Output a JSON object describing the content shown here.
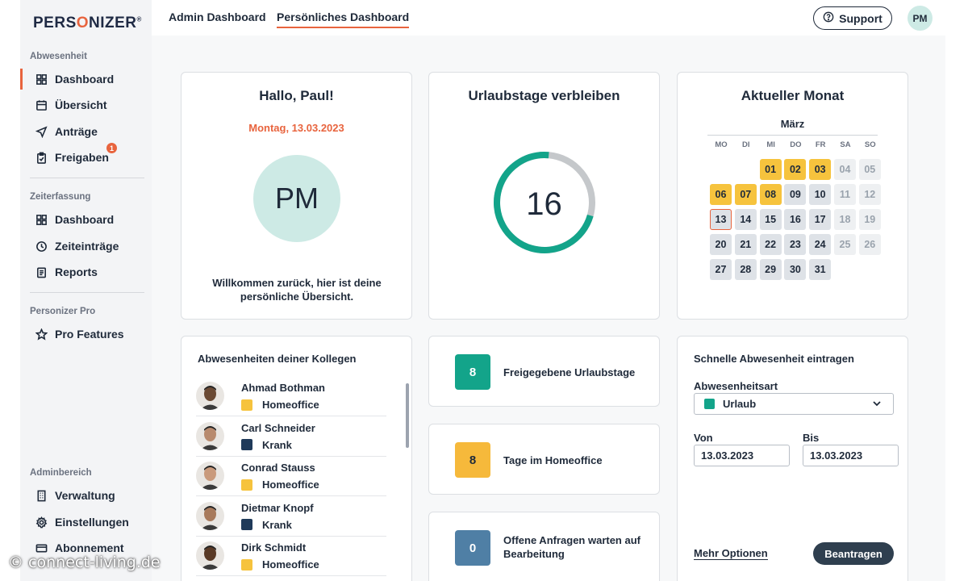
{
  "logo": {
    "text_pre": "PERS",
    "text_o": "O",
    "text_post": "NIZER",
    "mark": "®"
  },
  "sidebar": {
    "sections": [
      {
        "title": "Abwesenheit"
      },
      {
        "title": "Zeiterfassung"
      },
      {
        "title": "Personizer Pro"
      },
      {
        "title": "Adminbereich"
      }
    ],
    "items": [
      {
        "label": "Dashboard",
        "icon": "grid-icon",
        "active": true
      },
      {
        "label": "Übersicht",
        "icon": "calendar-icon"
      },
      {
        "label": "Anträge",
        "icon": "send-icon"
      },
      {
        "label": "Freigaben",
        "icon": "clipboard-check-icon",
        "badge": "1"
      },
      {
        "label": "Dashboard",
        "icon": "grid-icon"
      },
      {
        "label": "Zeiteinträge",
        "icon": "clock-icon"
      },
      {
        "label": "Reports",
        "icon": "report-icon"
      },
      {
        "label": "Pro Features",
        "icon": "star-icon"
      },
      {
        "label": "Verwaltung",
        "icon": "building-icon"
      },
      {
        "label": "Einstellungen",
        "icon": "gear-icon"
      },
      {
        "label": "Abonnement",
        "icon": "card-icon"
      }
    ]
  },
  "header": {
    "tabs": [
      {
        "label": "Admin Dashboard"
      },
      {
        "label": "Persönliches Dashboard",
        "active": true
      }
    ],
    "support_label": "Support",
    "user_initials": "PM"
  },
  "greeting": {
    "title": "Hallo, Paul!",
    "date": "Montag, 13.03.2023",
    "initials": "PM",
    "welcome": "Willkommen zurück, hier ist deine persönliche Übersicht."
  },
  "vacation": {
    "title": "Urlaubstage verbleiben",
    "days": "16",
    "fraction_used": 0.72,
    "ring_color": "#13a48a"
  },
  "calendar": {
    "title": "Aktueller Monat",
    "month": "März",
    "weekdays": [
      "MO",
      "DI",
      "MI",
      "DO",
      "FR",
      "SA",
      "SO"
    ],
    "days": [
      [
        "",
        "",
        "01",
        "02",
        "03",
        "04",
        "05"
      ],
      [
        "06",
        "07",
        "08",
        "09",
        "10",
        "11",
        "12"
      ],
      [
        "13",
        "14",
        "15",
        "16",
        "17",
        "18",
        "19"
      ],
      [
        "20",
        "21",
        "22",
        "23",
        "24",
        "25",
        "26"
      ],
      [
        "27",
        "28",
        "29",
        "30",
        "31",
        "",
        ""
      ]
    ],
    "orange_days": [
      "01",
      "02",
      "03",
      "06",
      "07",
      "08"
    ],
    "today": "13"
  },
  "colleagues": {
    "title": "Abwesenheiten deiner Kollegen",
    "list": [
      {
        "name": "Ahmad Bothman",
        "status": "Homeoffice",
        "color": "#f6c33d"
      },
      {
        "name": "Carl Schneider",
        "status": "Krank",
        "color": "#1f3a5a"
      },
      {
        "name": "Conrad Stauss",
        "status": "Homeoffice",
        "color": "#f6c33d"
      },
      {
        "name": "Dietmar Knopf",
        "status": "Krank",
        "color": "#1f3a5a"
      },
      {
        "name": "Dirk Schmidt",
        "status": "Homeoffice",
        "color": "#f6c33d"
      }
    ]
  },
  "stats": [
    {
      "value": "8",
      "label": "Freigegebene Urlaubstage",
      "color": "#13a48a"
    },
    {
      "value": "8",
      "label": "Tage im Homeoffice",
      "color": "#f6b93b"
    },
    {
      "value": "0",
      "label": "Offene Anfragen warten auf Bearbeitung",
      "color": "#4f7fa5"
    }
  ],
  "quick_absence": {
    "title": "Schnelle Abwesenheit eintragen",
    "type_label": "Abwesenheitsart",
    "type_value": "Urlaub",
    "from_label": "Von",
    "from_value": "13.03.2023",
    "to_label": "Bis",
    "to_value": "13.03.2023",
    "more_options": "Mehr Optionen",
    "submit": "Beantragen"
  },
  "watermark": "© connect-living.de"
}
